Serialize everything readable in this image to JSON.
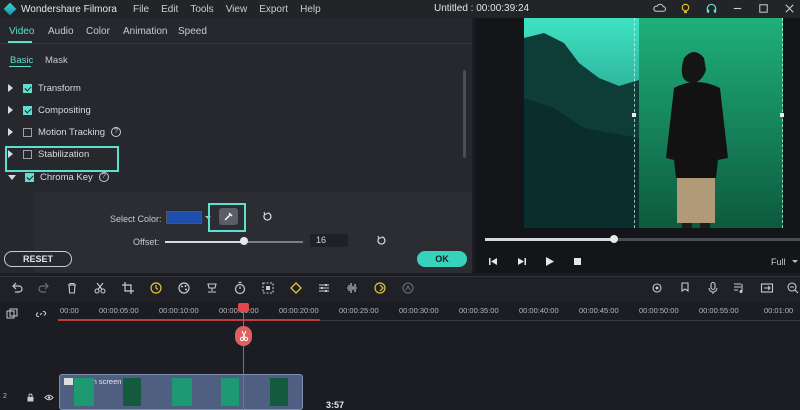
{
  "titlebar": {
    "app_name": "Wondershare Filmora",
    "menu": [
      "File",
      "Edit",
      "Tools",
      "View",
      "Export",
      "Help"
    ],
    "project_title": "Untitled : 00:00:39:24"
  },
  "tabs": [
    "Video",
    "Audio",
    "Color",
    "Animation",
    "Speed"
  ],
  "active_tab": "Video",
  "subtabs": [
    "Basic",
    "Mask"
  ],
  "active_subtab": "Basic",
  "properties": [
    {
      "label": "Transform",
      "checked": true,
      "expanded": false
    },
    {
      "label": "Compositing",
      "checked": true,
      "expanded": false
    },
    {
      "label": "Motion Tracking",
      "checked": false,
      "expanded": false,
      "help": true
    },
    {
      "label": "Stabilization",
      "checked": false,
      "expanded": false
    },
    {
      "label": "Chroma Key",
      "checked": true,
      "expanded": true,
      "help": true
    }
  ],
  "chroma_key": {
    "select_color_label": "Select Color:",
    "selected_color": "#1e4faf",
    "offset_label": "Offset:",
    "offset_value": "16",
    "offset_fraction": 0.57
  },
  "buttons": {
    "reset": "RESET",
    "ok": "OK"
  },
  "preview": {
    "playback_progress": 0.41,
    "zoom": "Full"
  },
  "timeline": {
    "ruler": [
      "00:00",
      "00:00:05:00",
      "00:00:10:00",
      "00:00:15:00",
      "00:00:20:00",
      "00:00:25:00",
      "00:00:30:00",
      "00:00:35:00",
      "00:00:40:00",
      "00:00:45:00",
      "00:00:50:00",
      "00:00:55:00",
      "00:01:00"
    ],
    "clip_name": "Green screen video",
    "time_label": "3:57",
    "track_number": "2"
  },
  "colors": {
    "accent": "#5fe0cf",
    "ok_button": "#36d2bc",
    "playhead": "#e0484e",
    "clip": "#4f5f82"
  }
}
